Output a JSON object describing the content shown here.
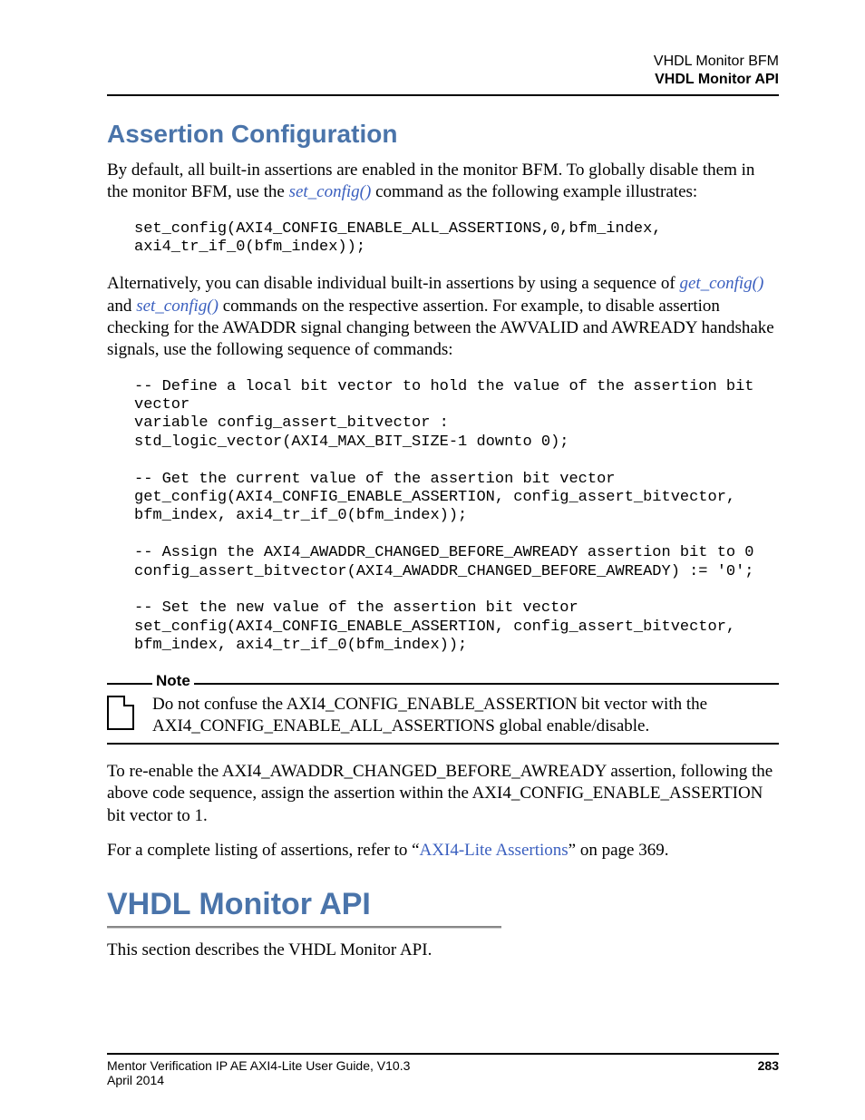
{
  "header": {
    "line1": "VHDL Monitor BFM",
    "line2": "VHDL Monitor API"
  },
  "section1": {
    "heading": "Assertion Configuration",
    "para1_a": "By default, all built-in assertions are enabled in the monitor BFM. To globally disable them in the monitor BFM, use the ",
    "para1_link": "set_config()",
    "para1_b": " command as the following example illustrates:",
    "code1": "set_config(AXI4_CONFIG_ENABLE_ALL_ASSERTIONS,0,bfm_index,\naxi4_tr_if_0(bfm_index));",
    "para2_a": "Alternatively, you can disable individual built-in assertions by using a sequence of ",
    "para2_link1": "get_config()",
    "para2_b": " and ",
    "para2_link2": "set_config()",
    "para2_c": " commands on the respective assertion. For example, to disable assertion checking for the AWADDR signal changing between the AWVALID and AWREADY handshake signals, use the following sequence of commands:",
    "code2": "-- Define a local bit vector to hold the value of the assertion bit vector\nvariable config_assert_bitvector : std_logic_vector(AXI4_MAX_BIT_SIZE-1 downto 0);\n\n-- Get the current value of the assertion bit vector\nget_config(AXI4_CONFIG_ENABLE_ASSERTION, config_assert_bitvector, bfm_index, axi4_tr_if_0(bfm_index));\n\n-- Assign the AXI4_AWADDR_CHANGED_BEFORE_AWREADY assertion bit to 0\nconfig_assert_bitvector(AXI4_AWADDR_CHANGED_BEFORE_AWREADY) := '0';\n\n-- Set the new value of the assertion bit vector\nset_config(AXI4_CONFIG_ENABLE_ASSERTION, config_assert_bitvector, bfm_index, axi4_tr_if_0(bfm_index));",
    "note_label": "Note",
    "note_text": "Do not confuse the AXI4_CONFIG_ENABLE_ASSERTION bit vector with the AXI4_CONFIG_ENABLE_ALL_ASSERTIONS global enable/disable.",
    "para3": "To re-enable the AXI4_AWADDR_CHANGED_BEFORE_AWREADY assertion, following the above code sequence, assign the assertion within the AXI4_CONFIG_ENABLE_ASSERTION bit vector to 1.",
    "para4_a": "For a complete listing of assertions, refer to “",
    "para4_link": "AXI4-Lite Assertions",
    "para4_b": "” on page 369."
  },
  "section2": {
    "heading": "VHDL Monitor API",
    "para1": "This section describes the VHDL Monitor API."
  },
  "footer": {
    "title": "Mentor Verification IP AE AXI4-Lite User Guide, V10.3",
    "page": "283",
    "date": "April 2014"
  }
}
